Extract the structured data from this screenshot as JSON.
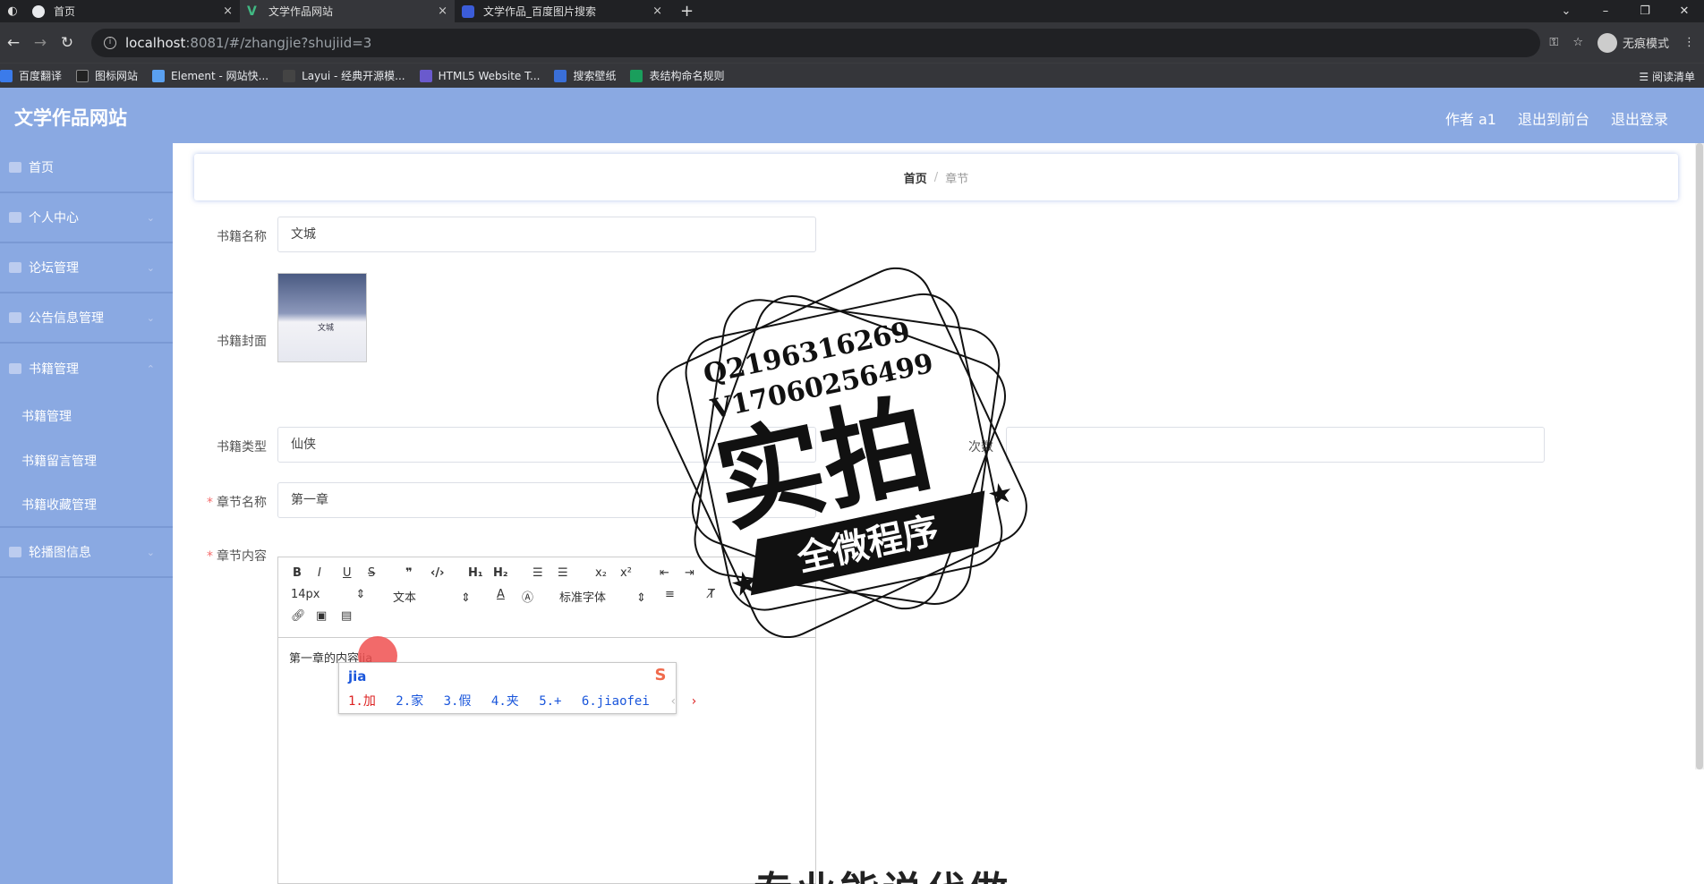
{
  "browser": {
    "tabs": [
      {
        "title": "首页",
        "close": "×"
      },
      {
        "title": "文学作品网站",
        "close": "×"
      },
      {
        "title": "文学作品_百度图片搜索",
        "close": "×"
      }
    ],
    "new_tab": "+",
    "url_host": "localhost",
    "url_path": ":8081/#/zhangjie?shujiid=3",
    "incognito_label": "无痕模式",
    "bookmarks": [
      "百度翻译",
      "图标网站",
      "Element - 网站快...",
      "Layui - 经典开源模...",
      "HTML5 Website T...",
      "搜索壁纸",
      "表结构命名规则"
    ],
    "reading_list": "阅读清单",
    "bookmark_colors": [
      "#3b7bea",
      "#222222",
      "#5aa0f0",
      "#444444",
      "#6a5acd",
      "#3a6fd8",
      "#1a9e5c"
    ]
  },
  "header": {
    "title": "文学作品网站",
    "nav": [
      "作者 a1",
      "退出到前台",
      "退出登录"
    ]
  },
  "sidebar": {
    "items": [
      "首页",
      "个人中心",
      "论坛管理",
      "公告信息管理",
      "书籍管理"
    ],
    "sub_items": [
      "书籍管理",
      "书籍留言管理",
      "书籍收藏管理"
    ],
    "last_item": "轮播图信息"
  },
  "breadcrumb": {
    "home": "首页",
    "separator": "/",
    "current": "章节"
  },
  "form": {
    "book_name_label": "书籍名称",
    "book_name_value": "文城",
    "cover_label": "书籍封面",
    "cover_text": "文城",
    "book_type_label": "书籍类型",
    "book_type_value": "仙侠",
    "right_label_fragment": "次数",
    "chapter_name_label": "章节名称",
    "chapter_name_value": "第一章",
    "chapter_content_label": "章节内容",
    "required_mark": "*"
  },
  "editor": {
    "font_size": "14px",
    "block_type": "文本",
    "font_family": "标准字体",
    "content": "第一章的内容jia"
  },
  "ime": {
    "input": "jia",
    "candidates": [
      "1.加",
      "2.家",
      "3.假",
      "4.夹",
      "5.+",
      "6.jiaofei"
    ],
    "logo": "S"
  },
  "watermark": {
    "line1": "Q2196316269",
    "line2": "V17060256499",
    "main": "实拍",
    "banner": "全微程序"
  },
  "bottom_text": "专业能说代做"
}
